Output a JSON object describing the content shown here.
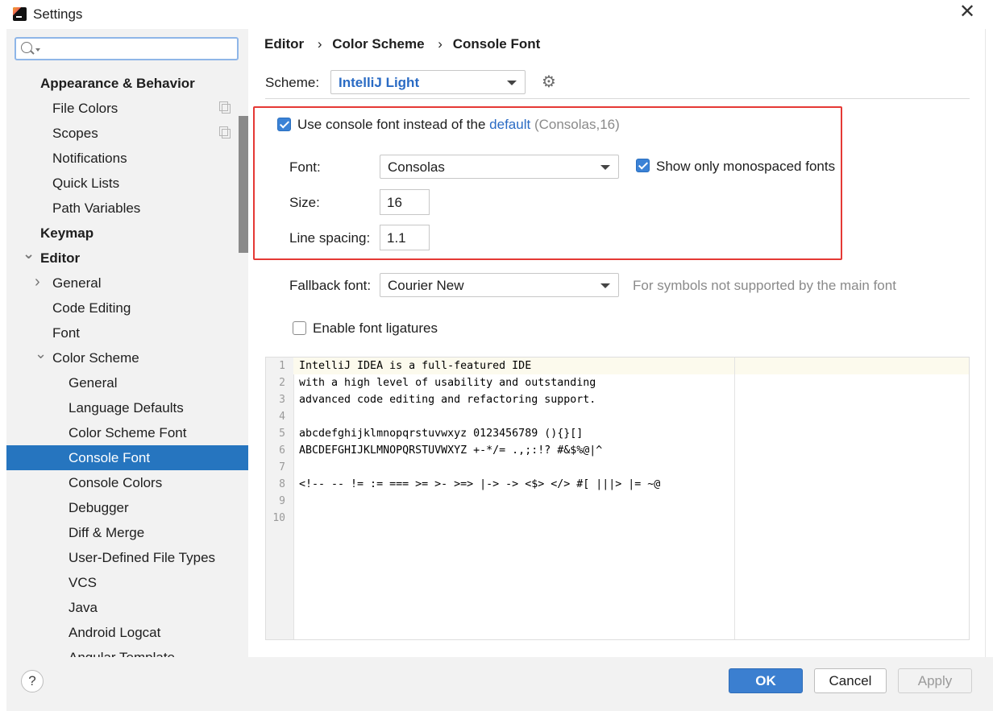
{
  "window": {
    "title": "Settings",
    "close_glyph": "✕"
  },
  "search": {
    "placeholder": "",
    "value": ""
  },
  "sidebar": {
    "items": [
      {
        "label": "Appearance & Behavior",
        "level": 0,
        "bold": true
      },
      {
        "label": "File Colors",
        "level": 1,
        "copy": true
      },
      {
        "label": "Scopes",
        "level": 1,
        "copy": true
      },
      {
        "label": "Notifications",
        "level": 1
      },
      {
        "label": "Quick Lists",
        "level": 1
      },
      {
        "label": "Path Variables",
        "level": 1
      },
      {
        "label": "Keymap",
        "level": 0,
        "bold": true
      },
      {
        "label": "Editor",
        "level": 0,
        "bold": true,
        "arrow": "expanded"
      },
      {
        "label": "General",
        "level": 1,
        "arrow": "collapsed"
      },
      {
        "label": "Code Editing",
        "level": 1
      },
      {
        "label": "Font",
        "level": 1
      },
      {
        "label": "Color Scheme",
        "level": 1,
        "arrow": "expanded"
      },
      {
        "label": "General",
        "level": 2
      },
      {
        "label": "Language Defaults",
        "level": 2
      },
      {
        "label": "Color Scheme Font",
        "level": 2
      },
      {
        "label": "Console Font",
        "level": 2,
        "selected": true
      },
      {
        "label": "Console Colors",
        "level": 2
      },
      {
        "label": "Debugger",
        "level": 2
      },
      {
        "label": "Diff & Merge",
        "level": 2
      },
      {
        "label": "User-Defined File Types",
        "level": 2
      },
      {
        "label": "VCS",
        "level": 2
      },
      {
        "label": "Java",
        "level": 2
      },
      {
        "label": "Android Logcat",
        "level": 2
      },
      {
        "label": "Angular Template",
        "level": 2
      }
    ]
  },
  "breadcrumb": [
    "Editor",
    "Color Scheme",
    "Console Font"
  ],
  "breadcrumb_sep": "›",
  "scheme": {
    "label": "Scheme:",
    "value": "IntelliJ Light"
  },
  "use_console_font": {
    "checked": true,
    "label_before": "Use console font instead of the",
    "link": "default",
    "hint": "(Consolas,16)"
  },
  "font": {
    "label": "Font:",
    "value": "Consolas"
  },
  "monospaced": {
    "checked": true,
    "label": "Show only monospaced fonts"
  },
  "size": {
    "label": "Size:",
    "value": "16"
  },
  "line_spacing": {
    "label": "Line spacing:",
    "value": "1.1"
  },
  "fallback": {
    "label": "Fallback font:",
    "value": "Courier New",
    "hint": "For symbols not supported by the main font"
  },
  "ligatures": {
    "checked": false,
    "label": "Enable font ligatures"
  },
  "preview": {
    "lines": [
      "IntelliJ IDEA is a full-featured IDE",
      "with a high level of usability and outstanding",
      "advanced code editing and refactoring support.",
      "",
      "abcdefghijklmnopqrstuvwxyz 0123456789 (){}[]",
      "ABCDEFGHIJKLMNOPQRSTUVWXYZ +-*/= .,;:!? #&$%@|^",
      "",
      "<!-- -- != := === >= >- >=> |-> -> <$> </> #[ |||> |= ~@",
      "",
      ""
    ]
  },
  "buttons": {
    "help": "?",
    "ok": "OK",
    "cancel": "Cancel",
    "apply": "Apply"
  },
  "colors": {
    "accent": "#2675bf",
    "highlight_box": "#e53935",
    "link": "#2a6bc4"
  }
}
